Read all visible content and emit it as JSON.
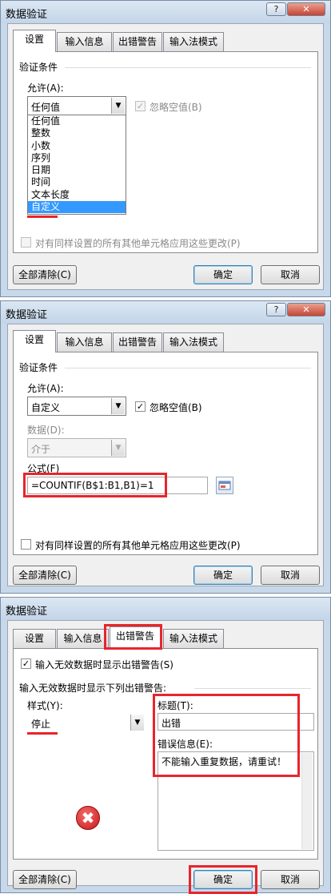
{
  "dialog1": {
    "title": "数据验证",
    "help": "?",
    "close": "✕",
    "tabs": [
      "设置",
      "输入信息",
      "出错警告",
      "输入法模式"
    ],
    "section_label": "验证条件",
    "allow_label": "允许(A):",
    "allow_value": "任何值",
    "ignore_blank_label": "忽略空值(B)",
    "allow_options": [
      "任何值",
      "整数",
      "小数",
      "序列",
      "日期",
      "时间",
      "文本长度",
      "自定义"
    ],
    "selected_option": "自定义",
    "apply_all_label": "对有同样设置的所有其他单元格应用这些更改(P)",
    "clear_all": "全部清除(C)",
    "ok": "确定",
    "cancel": "取消"
  },
  "dialog2": {
    "title": "数据验证",
    "help": "?",
    "close": "✕",
    "tabs": [
      "设置",
      "输入信息",
      "出错警告",
      "输入法模式"
    ],
    "section_label": "验证条件",
    "allow_label": "允许(A):",
    "allow_value": "自定义",
    "ignore_blank_label": "忽略空值(B)",
    "ignore_blank_checked": "✓",
    "data_label": "数据(D):",
    "data_value": "介于",
    "formula_label": "公式(F)",
    "formula_value": "=COUNTIF(B$1:B1,B1)=1",
    "apply_all_label": "对有同样设置的所有其他单元格应用这些更改(P)",
    "clear_all": "全部清除(C)",
    "ok": "确定",
    "cancel": "取消"
  },
  "dialog3": {
    "title": "数据验证",
    "help": "?",
    "close": "✕",
    "tabs": [
      "设置",
      "输入信息",
      "出错警告",
      "输入法模式"
    ],
    "show_alert_label": "输入无效数据时显示出错警告(S)",
    "show_alert_checked": "✓",
    "section_label": "输入无效数据时显示下列出错警告:",
    "style_label": "样式(Y):",
    "style_value": "停止",
    "title_label": "标题(T):",
    "title_value": "出错",
    "message_label": "错误信息(E):",
    "message_value": "不能输入重复数据，请重试！",
    "stop_icon": "✖",
    "clear_all": "全部清除(C)",
    "ok": "确定",
    "cancel": "取消"
  },
  "icons": {
    "dropdown": "▼",
    "stop": "stop-icon",
    "collapse": "ref-collapse-icon"
  },
  "colors": {
    "highlight_red": "#e8252c",
    "selection_blue": "#3399ff",
    "frame": "#c7d8ea"
  }
}
